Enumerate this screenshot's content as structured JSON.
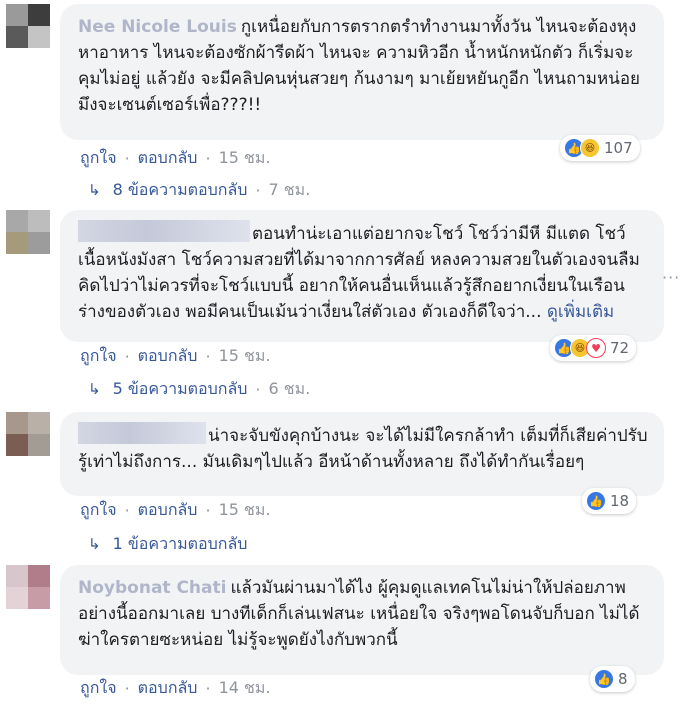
{
  "comments": [
    {
      "author": "Nee Nicole Louis",
      "text": "กูเหนื่อยกับการตรากตรำทำงานมาทั้งวัน ไหนจะต้องหุงหาอาหาร ไหนจะต้องซักผ้ารีดผ้า ไหนจะ ความหิวอีก น้ำหนักหนักตัว ก็เริ่มจะคุมไม่อยู่ แล้วยัง จะมีคลิปคนหุ่นสวยๆ ก้นงามๆ มาเย้ยหยันกูอีก ไหนถามหน่อย มึงจะเซนต์เซอร์เพื่อ???!!",
      "see_more": "",
      "reactions": [
        "like",
        "haha"
      ],
      "reaction_count": "107",
      "like": "ถูกใจ",
      "reply": "ตอบกลับ",
      "time": "15 ชม.",
      "replies_label": "8 ข้อความตอบกลับ",
      "replies_time": "7 ชม."
    },
    {
      "author": "",
      "text": "ตอนทำน่ะเอาแต่อยากจะโชว์ โชว์ว่ามีหี มีแตด โชว์เนื้อหนังมังสา โชว์ความสวยที่ได้มาจากการศัลย์ หลงความสวยในตัวเองจนลืมคิดไปว่าไม่ควรที่จะโชว์แบบนี้ อยากให้คนอื่นเห็นแล้วรู้สึกอยากเงี่ยนในเรือนร่างของตัวเอง พอมีคนเป็นเม้นว่าเงี่ยนใส่ตัวเอง ตัวเองก็ดีใจว่า...",
      "see_more": "ดูเพิ่มเติม",
      "reactions": [
        "like",
        "haha",
        "love"
      ],
      "reaction_count": "72",
      "like": "ถูกใจ",
      "reply": "ตอบกลับ",
      "time": "15 ชม.",
      "replies_label": "5 ข้อความตอบกลับ",
      "replies_time": "6 ชม."
    },
    {
      "author": "",
      "text": "น่าจะจับขังคุกบ้างนะ จะได้ไม่มีใครกล้าทำ เต็มที่ก็เสียค่าปรับ รู้เท่าไม่ถึงการ... มันเดิมๆไปแล้ว อีหน้าด้านทั้งหลาย ถึงได้ทำกันเรื่อยๆ",
      "see_more": "",
      "reactions": [
        "like"
      ],
      "reaction_count": "18",
      "like": "ถูกใจ",
      "reply": "ตอบกลับ",
      "time": "15 ชม.",
      "replies_label": "1 ข้อความตอบกลับ",
      "replies_time": ""
    },
    {
      "author": "Noybonat Chati",
      "text": "แล้วมันผ่านมาได้ไง ผู้คุมดูแลเทคโนไม่น่าให้ปล่อยภาพอย่างนี้ออกมาเลย บางทีเด็กก็เล่นเฟสนะ เหนื่อยใจ จริงๆพอโดนจับก็บอก ไม่ได้ฆ่าใครตายซะหน่อย ไม่รู้จะพูดยังไงกับพวกนี้",
      "see_more": "",
      "reactions": [
        "like"
      ],
      "reaction_count": "8",
      "like": "ถูกใจ",
      "reply": "ตอบกลับ",
      "time": "14 ชม.",
      "replies_label": "",
      "replies_time": ""
    }
  ],
  "colors": {
    "link": "#385898",
    "meta": "#90949c",
    "bubble": "#f2f3f5",
    "like_blue": "#3578e5",
    "haha_yellow": "#f7c532",
    "love_red": "#f33e58"
  }
}
